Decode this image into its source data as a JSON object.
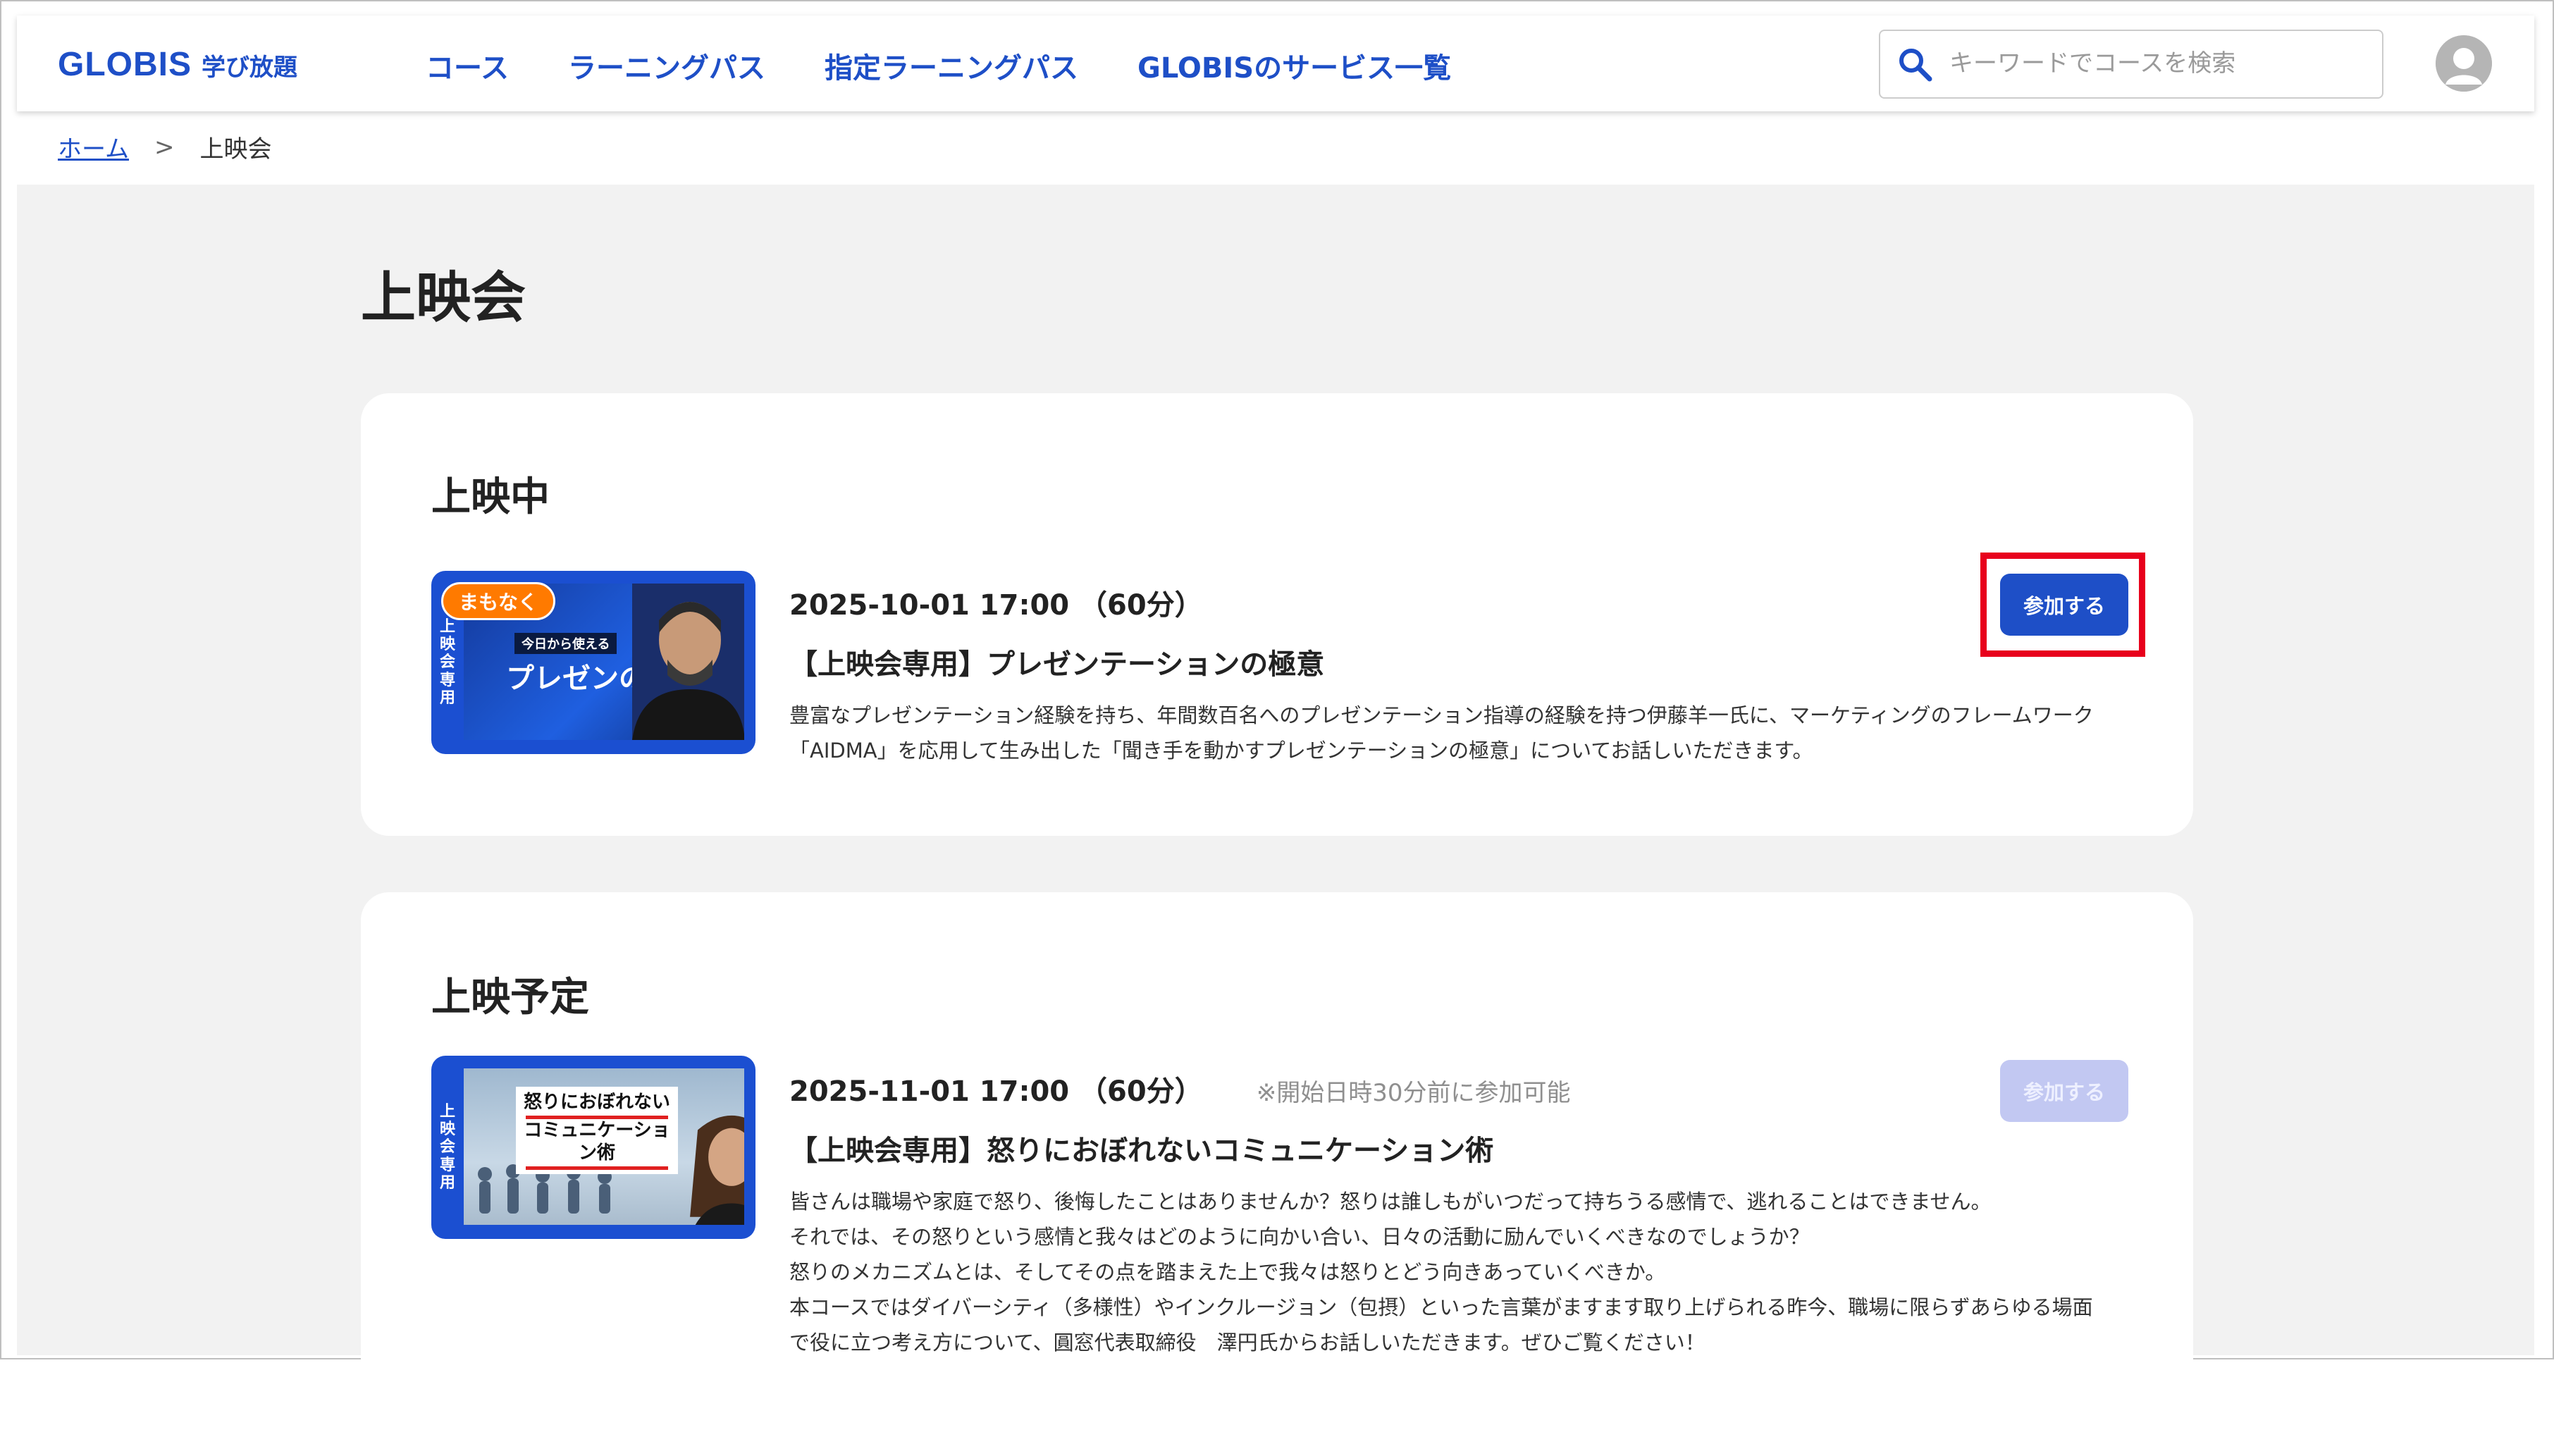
{
  "header": {
    "logo_main": "GLOBIS",
    "logo_sub": "学び放題",
    "nav": [
      {
        "label": "コース"
      },
      {
        "label": "ラーニングパス"
      },
      {
        "label": "指定ラーニングパス"
      },
      {
        "label": "GLOBISのサービス一覧"
      }
    ],
    "search": {
      "placeholder": "キーワードでコースを検索",
      "value": ""
    }
  },
  "breadcrumb": {
    "home": "ホーム",
    "separator": ">",
    "current": "上映会"
  },
  "page_title": "上映会",
  "colors": {
    "brand": "#1e4fc7",
    "badge": "#ff7a00",
    "highlight": "#e8001c",
    "disabled_button": "#c2c8f2"
  },
  "sections": [
    {
      "title": "上映中",
      "event": {
        "thumbnail": {
          "side_label": [
            "上",
            "映",
            "会",
            "専",
            "用"
          ],
          "badge": "まもなく",
          "tag": "今日から使える",
          "headline": "プレゼンの極意"
        },
        "datetime": "2025-10-01 17:00 （60分）",
        "title": "【上映会専用】プレゼンテーションの極意",
        "description": [
          "豊富なプレゼンテーション経験を持ち、年間数百名へのプレゼンテーション指導の経験を持つ伊藤羊一氏に、マーケティングのフレームワーク",
          "「AIDMA」を応用して生み出した「聞き手を動かすプレゼンテーションの極意」についてお話しいただきます。"
        ],
        "button": "参加する",
        "button_enabled": true
      }
    },
    {
      "title": "上映予定",
      "event": {
        "thumbnail": {
          "side_label": [
            "上",
            "映",
            "会",
            "専",
            "用"
          ],
          "headline_line1": "怒りにおぼれない",
          "headline_line2": "コミュニケーション術"
        },
        "datetime": "2025-11-01 17:00 （60分）",
        "note": "※開始日時30分前に参加可能",
        "title": "【上映会専用】怒りにおぼれないコミュニケーション術",
        "description": [
          "皆さんは職場や家庭で怒り、後悔したことはありませんか？怒りは誰しもがいつだって持ちうる感情で、逃れることはできません。",
          "それでは、その怒りという感情と我々はどのように向かい合い、日々の活動に励んでいくべきなのでしょうか？",
          "怒りのメカニズムとは、そしてその点を踏まえた上で我々は怒りとどう向きあっていくべきか。",
          "本コースではダイバーシティ（多様性）やインクルージョン（包摂）といった言葉がますます取り上げられる昨今、職場に限らずあらゆる場面",
          "で役に立つ考え方について、圓窓代表取締役　澤円氏からお話しいただきます。ぜひご覧ください！"
        ],
        "button": "参加する",
        "button_enabled": false
      }
    }
  ]
}
